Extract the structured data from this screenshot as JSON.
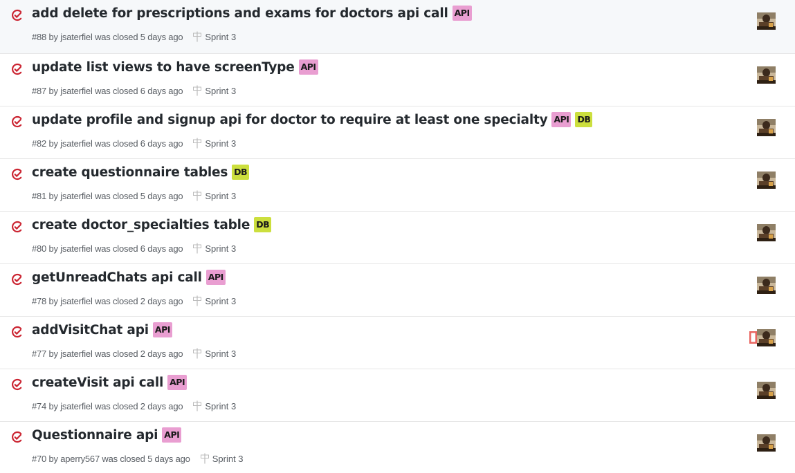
{
  "colors": {
    "closed_icon": "#cb2431",
    "label_api": "#e99ed1",
    "label_db": "#ccdf3e",
    "title_text": "#24292e",
    "meta_text": "#585d63"
  },
  "issues": [
    {
      "title": "add delete for prescriptions and exams for doctors api call",
      "labels": [
        {
          "text": "API",
          "color": "#e99ed1"
        }
      ],
      "meta": "#88 by jsaterfiel was closed 5 days ago",
      "milestone": "Sprint 3"
    },
    {
      "title": "update list views to have screenType",
      "labels": [
        {
          "text": "API",
          "color": "#e99ed1"
        }
      ],
      "meta": "#87 by jsaterfiel was closed 6 days ago",
      "milestone": "Sprint 3"
    },
    {
      "title": "update profile and signup api for doctor to require at least one specialty",
      "labels": [
        {
          "text": "API",
          "color": "#e99ed1"
        },
        {
          "text": "DB",
          "color": "#ccdf3e"
        }
      ],
      "meta": "#82 by jsaterfiel was closed 6 days ago",
      "milestone": "Sprint 3"
    },
    {
      "title": "create questionnaire tables",
      "labels": [
        {
          "text": "DB",
          "color": "#ccdf3e"
        }
      ],
      "meta": "#81 by jsaterfiel was closed 5 days ago",
      "milestone": "Sprint 3"
    },
    {
      "title": "create doctor_specialties table",
      "labels": [
        {
          "text": "DB",
          "color": "#ccdf3e"
        }
      ],
      "meta": "#80 by jsaterfiel was closed 6 days ago",
      "milestone": "Sprint 3"
    },
    {
      "title": "getUnreadChats api call",
      "labels": [
        {
          "text": "API",
          "color": "#e99ed1"
        }
      ],
      "meta": "#78 by jsaterfiel was closed 2 days ago",
      "milestone": "Sprint 3"
    },
    {
      "title": "addVisitChat api",
      "labels": [
        {
          "text": "API",
          "color": "#e99ed1"
        }
      ],
      "meta": "#77 by jsaterfiel was closed 2 days ago",
      "milestone": "Sprint 3",
      "multiple_assignees": true
    },
    {
      "title": "createVisit api call",
      "labels": [
        {
          "text": "API",
          "color": "#e99ed1"
        }
      ],
      "meta": "#74 by jsaterfiel was closed 2 days ago",
      "milestone": "Sprint 3"
    },
    {
      "title": "Questionnaire api",
      "labels": [
        {
          "text": "API",
          "color": "#e99ed1"
        }
      ],
      "meta": "#70 by aperry567 was closed 5 days ago",
      "milestone": "Sprint 3"
    }
  ]
}
